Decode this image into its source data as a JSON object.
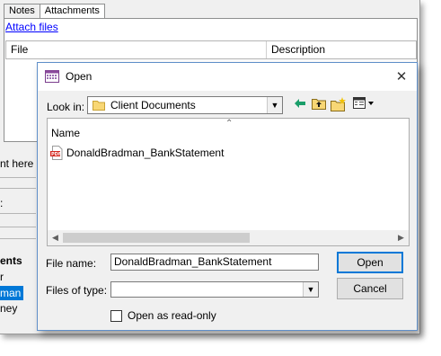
{
  "background": {
    "tabs": [
      {
        "label": "Notes"
      },
      {
        "label": "Attachments"
      }
    ],
    "attach_link": "Attach files",
    "columns": {
      "file": "File",
      "description": "Description"
    },
    "partial_texts": {
      "t1": "nt here",
      "t2": ":",
      "t3": "ents",
      "t4": "r",
      "t5": "man",
      "t6": "ney"
    }
  },
  "dialog": {
    "title": "Open",
    "look_in_label": "Look in:",
    "look_in_value": "Client Documents",
    "list_column": "Name",
    "files": [
      {
        "name": "DonaldBradman_BankStatement",
        "icon": "pdf-icon"
      }
    ],
    "file_name_label": "File name:",
    "file_name_value": "DonaldBradman_BankStatement",
    "files_of_type_label": "Files of type:",
    "files_of_type_value": "",
    "open_button": "Open",
    "cancel_button": "Cancel",
    "readonly_label": "Open as read-only",
    "readonly_checked": false,
    "accent": "#0078d7"
  }
}
